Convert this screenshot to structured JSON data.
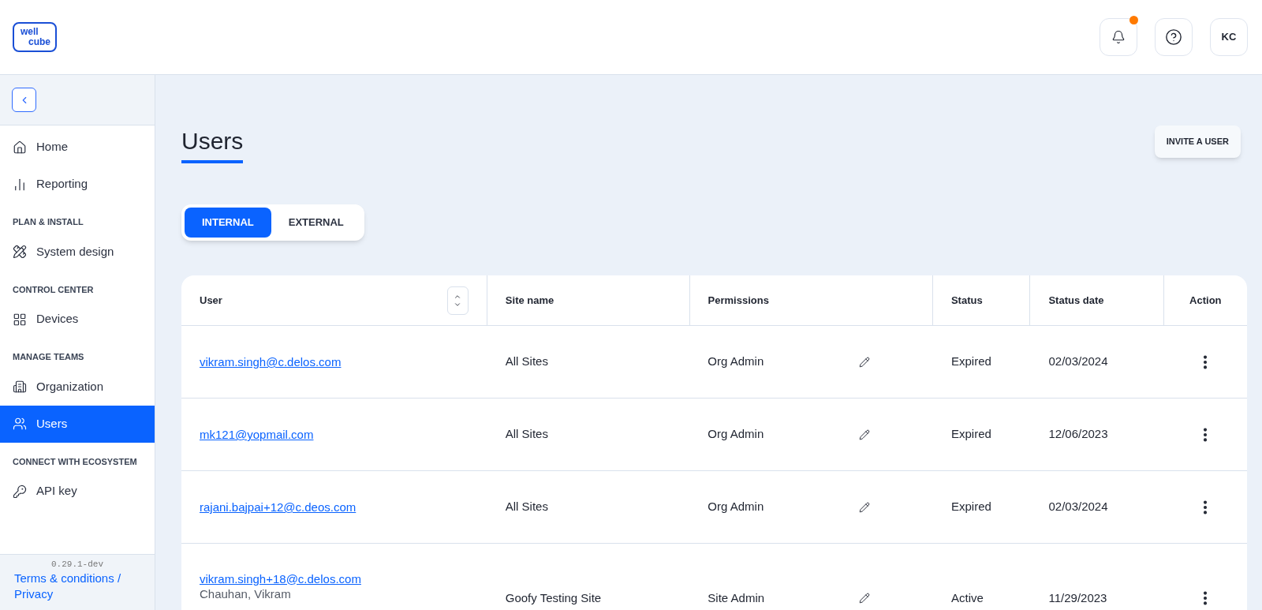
{
  "logo": {
    "lines": [
      "well",
      "cube"
    ]
  },
  "header": {
    "notification_badge": true,
    "avatar": "KC"
  },
  "sidebar": {
    "groups": [
      {
        "items": [
          {
            "label": "Home",
            "selected": false
          },
          {
            "label": "Reporting",
            "selected": false
          }
        ]
      },
      {
        "heading": "PLAN & INSTALL",
        "items": [
          {
            "label": "System design",
            "selected": false
          }
        ]
      },
      {
        "heading": "CONTROL CENTER",
        "items": [
          {
            "label": "Devices",
            "selected": false
          }
        ]
      },
      {
        "heading": "MANAGE TEAMS",
        "items": [
          {
            "label": "Organization",
            "selected": false
          },
          {
            "label": "Users",
            "selected": true
          }
        ]
      },
      {
        "heading": "CONNECT WITH ECOSYSTEM",
        "items": [
          {
            "label": "API key",
            "selected": false
          }
        ]
      }
    ],
    "version": "0.29.1-dev",
    "footer_link": "Terms & conditions / Privacy"
  },
  "page": {
    "title": "Users",
    "invite_button": "INVITE A USER"
  },
  "tabs": [
    {
      "label": "INTERNAL",
      "selected": true
    },
    {
      "label": "EXTERNAL",
      "selected": false
    }
  ],
  "table": {
    "columns": [
      "User",
      "Site name",
      "Permissions",
      "Status",
      "Status date",
      "Action"
    ],
    "rows": [
      {
        "user": "vikram.singh@c.delos.com",
        "site": "All Sites",
        "permission": "Org Admin",
        "status": "Expired",
        "date": "02/03/2024"
      },
      {
        "user": "mk121@yopmail.com",
        "site": "All Sites",
        "permission": "Org Admin",
        "status": "Expired",
        "date": "12/06/2023"
      },
      {
        "user": "rajani.bajpai+12@c.deos.com",
        "site": "All Sites",
        "permission": "Org Admin",
        "status": "Expired",
        "date": "02/03/2024"
      },
      {
        "user": "vikram.singh+18@c.delos.com",
        "name": "Chauhan, Vikram",
        "site": "Goofy Testing Site",
        "permission": "Site Admin",
        "status": "Active",
        "date": "11/29/2023"
      }
    ]
  }
}
